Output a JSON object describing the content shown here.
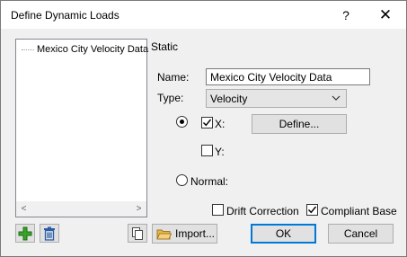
{
  "window": {
    "title": "Define Dynamic Loads",
    "help_glyph": "?",
    "close_glyph": "✕"
  },
  "tree": {
    "items": [
      {
        "label": "Mexico City Velocity Data"
      }
    ],
    "scroll_left": "<",
    "scroll_right": ">"
  },
  "form": {
    "section_label": "Static",
    "name_label": "Name:",
    "name_value": "Mexico City Velocity Data",
    "type_label": "Type:",
    "type_value": "Velocity",
    "x_label": "X:",
    "x_checked": true,
    "define_label": "Define...",
    "y_label": "Y:",
    "y_checked": false,
    "normal_label": "Normal:",
    "mode_selected": "X",
    "drift_label": "Drift Correction",
    "drift_checked": false,
    "compliant_label": "Compliant Base",
    "compliant_checked": true
  },
  "footer": {
    "import_label": "Import...",
    "ok_label": "OK",
    "cancel_label": "Cancel"
  },
  "colors": {
    "add_icon": "#3aa329",
    "accent": "#0078d7",
    "folder": "#e8b64a"
  }
}
